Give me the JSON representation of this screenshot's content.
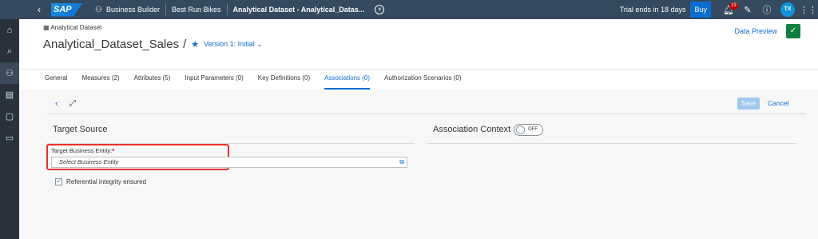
{
  "shell": {
    "logo": "SAP",
    "back_icon": "chevron-left-icon",
    "crumbs": [
      "Business Builder",
      "Best Run Bikes",
      "Analytical Dataset - Analytical_Datas..."
    ],
    "trial_text": "Trial ends in 18 days",
    "buy_label": "Buy",
    "notification_count": "19",
    "avatar_initials": "TX",
    "shell_bg": "#354a5f"
  },
  "leftnav": {
    "items": [
      "home-icon",
      "search-icon",
      "business-builder-icon",
      "data-builder-icon",
      "repository-icon",
      "monitor-icon"
    ],
    "active_index": 2
  },
  "header": {
    "breadcrumb": "Analytical Dataset",
    "title": "Analytical_Dataset_Sales",
    "separator": "/",
    "version": "Version 1: Initial",
    "data_preview": "Data Preview"
  },
  "tabs": [
    {
      "label": "General",
      "active": false
    },
    {
      "label": "Measures (2)",
      "active": false
    },
    {
      "label": "Attributes (5)",
      "active": false
    },
    {
      "label": "Input Parameters (0)",
      "active": false
    },
    {
      "label": "Key Definitions (0)",
      "active": false
    },
    {
      "label": "Associations (0)",
      "active": true
    },
    {
      "label": "Authorization Scenarios (0)",
      "active": false
    }
  ],
  "toolbar": {
    "save_label": "Save",
    "cancel_label": "Cancel"
  },
  "target_source": {
    "title": "Target Source",
    "field_label": "Target Business Entity:",
    "required_mark": "*",
    "input_placeholder": "Select Business Entity",
    "checkbox_label": "Referential integrity ensured",
    "checkbox_checked": true
  },
  "association_context": {
    "title": "Association Context",
    "toggle_label": "OFF"
  },
  "colors": {
    "accent": "#0a6ed1",
    "highlight": "#e8312b",
    "success": "#107e3e"
  }
}
